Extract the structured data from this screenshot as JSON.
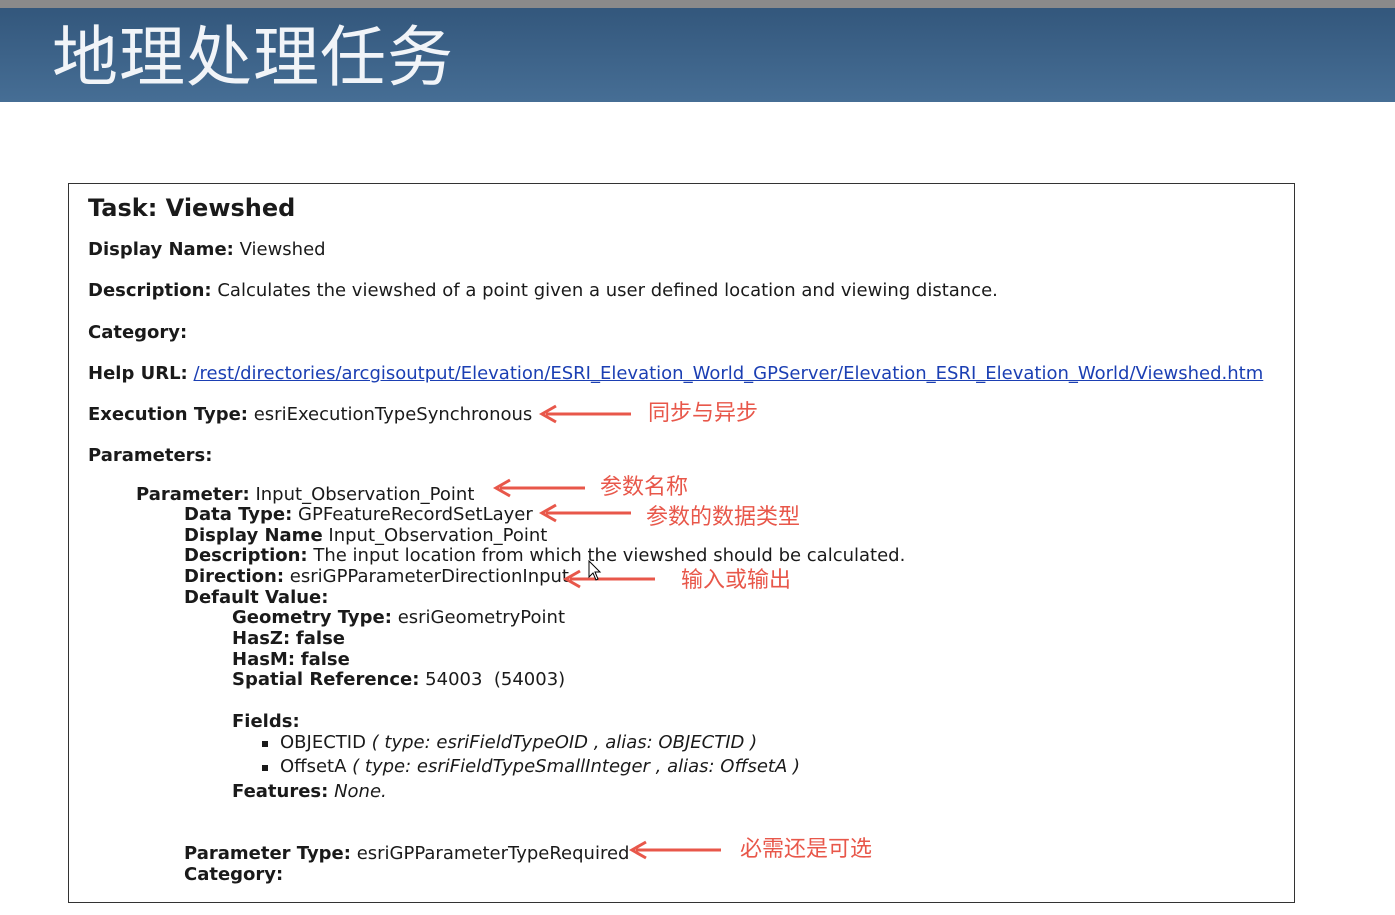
{
  "banner": {
    "title": "地理处理任务"
  },
  "task": {
    "title": "Task: Viewshed",
    "display_name_label": "Display Name:",
    "display_name": "Viewshed",
    "description_label": "Description:",
    "description": "Calculates the viewshed of a point given a user defined location and viewing distance.",
    "category_label": "Category:",
    "help_url_label": "Help URL:",
    "help_url": "/rest/directories/arcgisoutput/Elevation/ESRI_Elevation_World_GPServer/Elevation_ESRI_Elevation_World/Viewshed.htm",
    "execution_type_label": "Execution Type:",
    "execution_type": "esriExecutionTypeSynchronous",
    "parameters_label": "Parameters:"
  },
  "parameter": {
    "name_label": "Parameter:",
    "name": "Input_Observation_Point",
    "data_type_label": "Data Type:",
    "data_type": "GPFeatureRecordSetLayer",
    "display_name_label": "Display Name",
    "display_name": "Input_Observation_Point",
    "description_label": "Description:",
    "description": "The input location from which the viewshed should be calculated.",
    "direction_label": "Direction:",
    "direction": "esriGPParameterDirectionInput",
    "default_value_label": "Default Value:",
    "geometry_type_label": "Geometry Type:",
    "geometry_type": "esriGeometryPoint",
    "hasz_label": "HasZ:",
    "hasz": "false",
    "hasm_label": "HasM:",
    "hasm": "false",
    "spatial_ref_label": "Spatial Reference:",
    "spatial_ref": "54003  (54003)",
    "fields_label": "Fields:",
    "fields": [
      {
        "name": "OBJECTID",
        "detail": "( type: esriFieldTypeOID , alias: OBJECTID )"
      },
      {
        "name": "OffsetA",
        "detail": "( type: esriFieldTypeSmallInteger , alias: OffsetA )"
      }
    ],
    "features_label": "Features:",
    "features": "None.",
    "param_type_label": "Parameter Type:",
    "param_type": "esriGPParameterTypeRequired",
    "category_label": "Category:"
  },
  "annotations": {
    "sync_async": "同步与异步",
    "param_name": "参数名称",
    "param_datatype": "参数的数据类型",
    "input_output": "输入或输出",
    "required_optional": "必需还是可选"
  },
  "colors": {
    "banner": "#3a5f85",
    "annotation": "#e8574a",
    "link": "#1b3fb3"
  }
}
